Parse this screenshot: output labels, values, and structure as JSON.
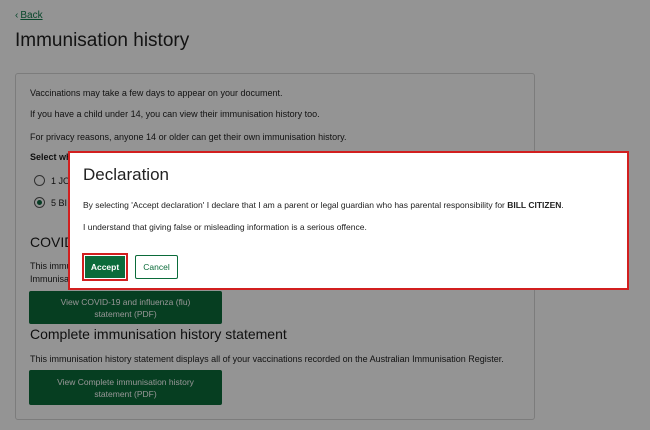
{
  "nav": {
    "back_label": "Back"
  },
  "page": {
    "title": "Immunisation history"
  },
  "card": {
    "notice_1": "Vaccinations may take a few days to appear on your document.",
    "notice_2": "If you have a child under 14, you can view their immunisation history too.",
    "notice_3": "For privacy reasons, anyone 14 or older can get their own immunisation history.",
    "select_label": "Select wh",
    "options": [
      {
        "label": "1 JO",
        "selected": false
      },
      {
        "label": "5 BI",
        "selected": true
      }
    ],
    "covid_heading": "COVID",
    "covid_text_1": "This immun",
    "covid_text_2": "Immunisat",
    "covid_button": "View COVID-19 and influenza (flu) statement (PDF)",
    "complete_heading": "Complete immunisation history statement",
    "complete_text": "This immunisation history statement displays all of your vaccinations recorded on the Australian Immunisation Register.",
    "complete_button": "View Complete immunisation history statement (PDF)"
  },
  "modal": {
    "title": "Declaration",
    "text_1_before": "By selecting 'Accept declaration' I declare that I am a parent or legal guardian who has parental responsibility for ",
    "text_1_name": "BILL CITIZEN",
    "text_1_after": ".",
    "text_2": "I understand that giving false or misleading information is a serious offence.",
    "accept_label": "Accept",
    "cancel_label": "Cancel"
  },
  "colors": {
    "brand_green": "#0b6b3a",
    "highlight_red": "#d21f1f",
    "link_green": "#0f7a4a"
  },
  "icons": {
    "back": "chevron-left-icon"
  }
}
